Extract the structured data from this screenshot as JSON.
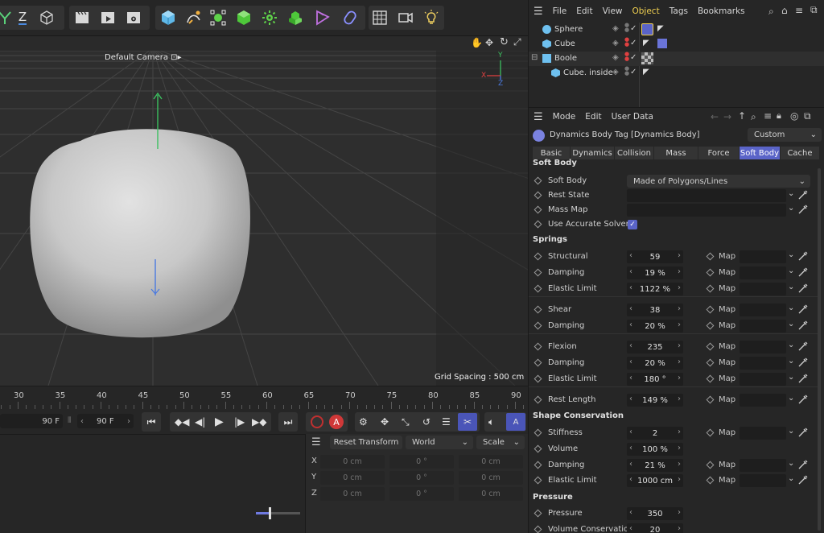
{
  "toolbar": {
    "left_icons": [
      "y-axis-lock-icon",
      "z-axis-lock-icon",
      "world-coordinates-icon"
    ],
    "render_icons": [
      "render-view-icon",
      "render-picture-viewer-icon",
      "render-settings-icon"
    ],
    "create_icons": [
      "cube-icon",
      "spline-pen-icon",
      "subdivision-icon",
      "extrude-icon",
      "cloner-icon",
      "volume-icon",
      "deformer-icon",
      "field-icon"
    ],
    "scene_icons": [
      "floor-icon",
      "camera-icon",
      "light-icon"
    ],
    "z_label": "Z"
  },
  "viewport": {
    "camera": "Default Camera",
    "grid_spacing": "Grid Spacing : 500 cm",
    "axis": {
      "y": "Y",
      "x": "X",
      "z": "Z"
    }
  },
  "timeline": {
    "ticks": [
      "30",
      "35",
      "40",
      "45",
      "50",
      "55",
      "60",
      "65",
      "70",
      "75",
      "80",
      "85",
      "90"
    ]
  },
  "transport": {
    "end_frame_left": "90 F",
    "end_frame": "90 F"
  },
  "coordinates": {
    "reset": "Reset Transform",
    "space": "World",
    "mode": "Scale",
    "rows": [
      {
        "axis": "X",
        "pos": "0 cm",
        "rot": "0 °",
        "size": "0 cm"
      },
      {
        "axis": "Y",
        "pos": "0 cm",
        "rot": "0 °",
        "size": "0 cm"
      },
      {
        "axis": "Z",
        "pos": "0 cm",
        "rot": "0 °",
        "size": "0 cm"
      }
    ]
  },
  "object_manager": {
    "menu": [
      "File",
      "Edit",
      "View",
      "Object",
      "Tags",
      "Bookmarks"
    ],
    "objects": [
      {
        "name": "Sphere",
        "indent": 0
      },
      {
        "name": "Cube",
        "indent": 0
      },
      {
        "name": "Boole",
        "indent": 0
      },
      {
        "name": "Cube. inside",
        "indent": 1
      }
    ]
  },
  "attribute_manager": {
    "menu": [
      "Mode",
      "Edit",
      "User Data"
    ],
    "title": "Dynamics Body Tag [Dynamics Body]",
    "preset": "Custom",
    "tabs": [
      "Basic",
      "Dynamics",
      "Collision",
      "Mass",
      "Force",
      "Soft Body",
      "Cache"
    ],
    "active_tab": "Soft Body",
    "soft_body_section": "Soft Body",
    "soft_body": {
      "label": "Soft Body",
      "value": "Made of Polygons/Lines",
      "rest_state": "Rest State",
      "mass_map": "Mass Map",
      "accurate_solver": "Use Accurate Solver"
    },
    "springs_section": "Springs",
    "map_label": "Map",
    "springs": [
      {
        "label": "Structural",
        "value": "59"
      },
      {
        "label": "Damping",
        "value": "19 %"
      },
      {
        "label": "Elastic Limit",
        "value": "1122 %"
      },
      {
        "label": "Shear",
        "value": "38"
      },
      {
        "label": "Damping",
        "value": "20 %"
      },
      {
        "label": "Flexion",
        "value": "235"
      },
      {
        "label": "Damping",
        "value": "20 %"
      },
      {
        "label": "Elastic Limit",
        "value": "180 °"
      },
      {
        "label": "Rest Length",
        "value": "149 %"
      }
    ],
    "shape_section": "Shape Conservation",
    "shape": [
      {
        "label": "Stiffness",
        "value": "2"
      },
      {
        "label": "Volume",
        "value": "100 %"
      },
      {
        "label": "Damping",
        "value": "21 %"
      },
      {
        "label": "Elastic Limit",
        "value": "1000 cm"
      }
    ],
    "pressure_section": "Pressure",
    "pressure": [
      {
        "label": "Pressure",
        "value": "350"
      },
      {
        "label": "Volume Conservation",
        "value": "20"
      }
    ]
  }
}
